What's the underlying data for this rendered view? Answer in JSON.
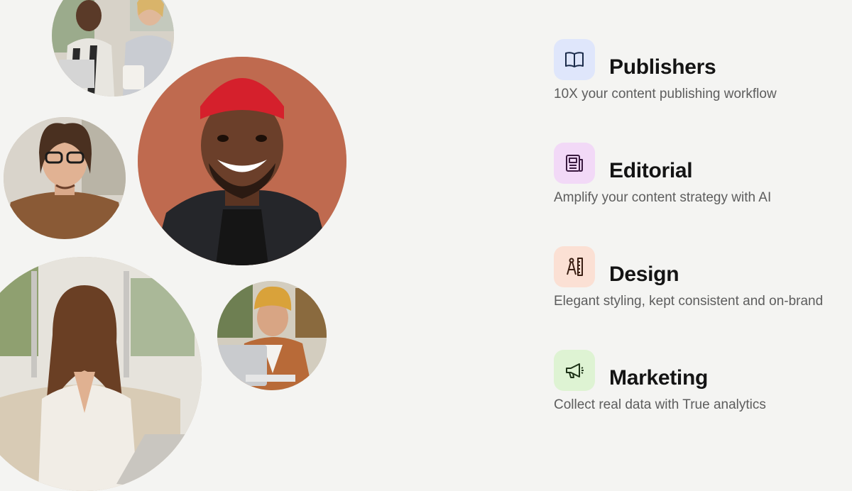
{
  "features": [
    {
      "title": "Publishers",
      "description": "10X your content publishing workflow",
      "icon": "open-book-icon",
      "icon_bg": "#dfe6fb"
    },
    {
      "title": "Editorial",
      "description": "Amplify your content strategy with AI",
      "icon": "newspaper-icon",
      "icon_bg": "#f2d9f7"
    },
    {
      "title": "Design",
      "description": "Elegant styling, kept consistent and on-brand",
      "icon": "compass-ruler-icon",
      "icon_bg": "#fbe0d4"
    },
    {
      "title": "Marketing",
      "description": "Collect real data with True analytics",
      "icon": "megaphone-icon",
      "icon_bg": "#def3d3"
    }
  ],
  "colors": {
    "background": "#f4f4f2",
    "title": "#141414",
    "description": "#5d5d5d"
  }
}
